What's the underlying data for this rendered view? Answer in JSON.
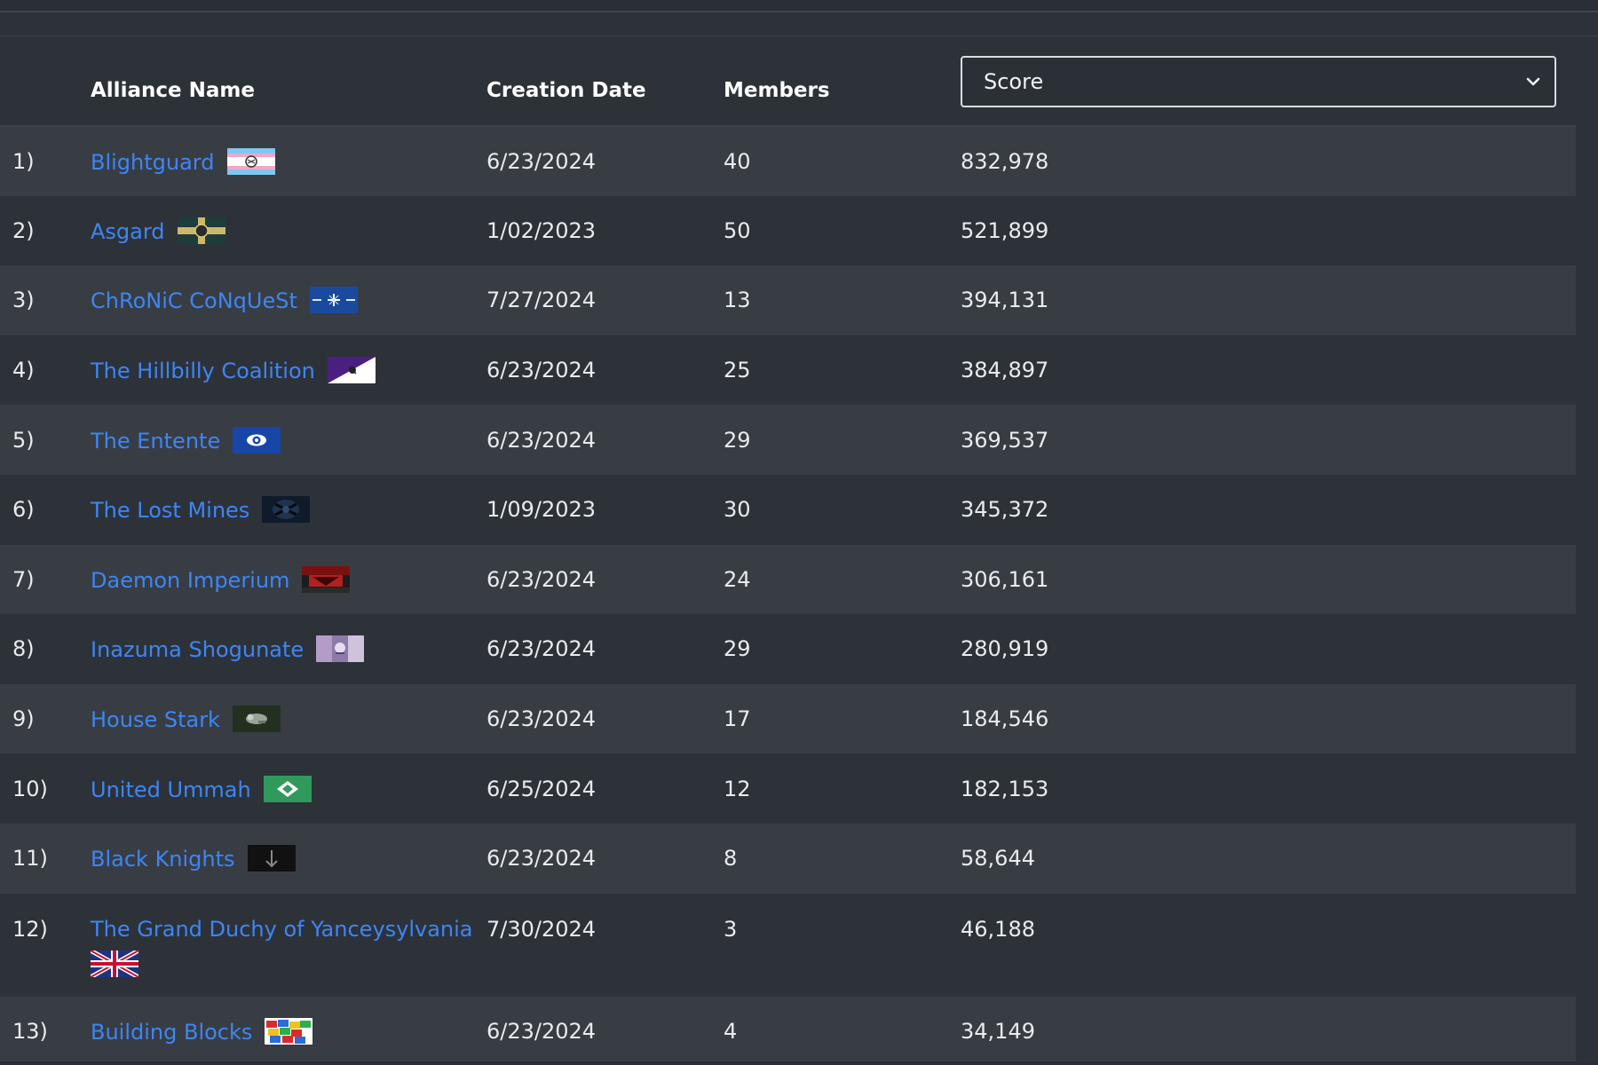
{
  "headers": {
    "rank": "",
    "name": "Alliance Name",
    "date": "Creation Date",
    "members": "Members"
  },
  "sort_select": {
    "selected": "Score",
    "icon": "chevron-down-icon"
  },
  "colors": {
    "link": "#3d86f5",
    "row_odd": "#383d44",
    "row_even": "#2d3239"
  },
  "rows": [
    {
      "rank": "1)",
      "name": "Blightguard",
      "date": "6/23/2024",
      "members": "40",
      "score": "832,978",
      "flag": "blightguard-flag-icon"
    },
    {
      "rank": "2)",
      "name": "Asgard",
      "date": "1/02/2023",
      "members": "50",
      "score": "521,899",
      "flag": "asgard-flag-icon"
    },
    {
      "rank": "3)",
      "name": "ChRoNiC CoNqUeSt",
      "date": "7/27/2024",
      "members": "13",
      "score": "394,131",
      "flag": "chronic-conquest-flag-icon"
    },
    {
      "rank": "4)",
      "name": "The Hillbilly Coalition",
      "date": "6/23/2024",
      "members": "25",
      "score": "384,897",
      "flag": "hillbilly-coalition-flag-icon"
    },
    {
      "rank": "5)",
      "name": "The Entente",
      "date": "6/23/2024",
      "members": "29",
      "score": "369,537",
      "flag": "entente-flag-icon"
    },
    {
      "rank": "6)",
      "name": "The Lost Mines",
      "date": "1/09/2023",
      "members": "30",
      "score": "345,372",
      "flag": "lost-mines-flag-icon"
    },
    {
      "rank": "7)",
      "name": "Daemon Imperium",
      "date": "6/23/2024",
      "members": "24",
      "score": "306,161",
      "flag": "daemon-imperium-flag-icon"
    },
    {
      "rank": "8)",
      "name": "Inazuma Shogunate",
      "date": "6/23/2024",
      "members": "29",
      "score": "280,919",
      "flag": "inazuma-shogunate-flag-icon"
    },
    {
      "rank": "9)",
      "name": "House Stark",
      "date": "6/23/2024",
      "members": "17",
      "score": "184,546",
      "flag": "house-stark-flag-icon"
    },
    {
      "rank": "10)",
      "name": "United Ummah",
      "date": "6/25/2024",
      "members": "12",
      "score": "182,153",
      "flag": "united-ummah-flag-icon"
    },
    {
      "rank": "11)",
      "name": "Black Knights",
      "date": "6/23/2024",
      "members": "8",
      "score": "58,644",
      "flag": "black-knights-flag-icon"
    },
    {
      "rank": "12)",
      "name": "The Grand Duchy of Yanceysylvania",
      "date": "7/30/2024",
      "members": "3",
      "score": "46,188",
      "flag": "yanceysylvania-flag-icon"
    },
    {
      "rank": "13)",
      "name": "Building Blocks",
      "date": "6/23/2024",
      "members": "4",
      "score": "34,149",
      "flag": "building-blocks-flag-icon"
    }
  ]
}
